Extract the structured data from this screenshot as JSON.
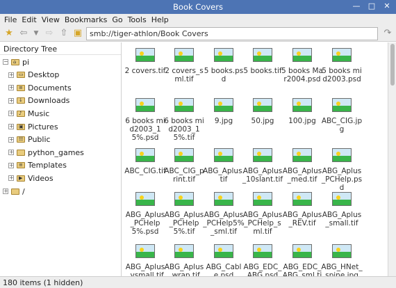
{
  "window": {
    "title": "Book Covers"
  },
  "menubar": {
    "items": [
      "File",
      "Edit",
      "View",
      "Bookmarks",
      "Go",
      "Tools",
      "Help"
    ]
  },
  "toolbar": {
    "location": "smb://tiger-athlon/Book Covers"
  },
  "sidebar": {
    "header": "Directory Tree",
    "items": [
      {
        "label": "pi",
        "glyph": "⌂",
        "expanded": true
      },
      {
        "label": "Desktop",
        "glyph": "▭"
      },
      {
        "label": "Documents",
        "glyph": "≡"
      },
      {
        "label": "Downloads",
        "glyph": "↓"
      },
      {
        "label": "Music",
        "glyph": "♪"
      },
      {
        "label": "Pictures",
        "glyph": "▣"
      },
      {
        "label": "Public",
        "glyph": "☷"
      },
      {
        "label": "python_games",
        "glyph": ""
      },
      {
        "label": "Templates",
        "glyph": "≡"
      },
      {
        "label": "Videos",
        "glyph": "▶"
      },
      {
        "label": "/",
        "glyph": ""
      }
    ]
  },
  "files": [
    {
      "name": "2 covers.tif"
    },
    {
      "name": "2 covers_sml.tif"
    },
    {
      "name": "5 books.psd"
    },
    {
      "name": "5 books.tif"
    },
    {
      "name": "5 books Mar2004.psd"
    },
    {
      "name": "5 books mid2003.psd"
    },
    {
      "name": "6 books mid2003_15%.psd"
    },
    {
      "name": "6 books mid2003_15%.tif"
    },
    {
      "name": "9.jpg"
    },
    {
      "name": "50.jpg"
    },
    {
      "name": "100.jpg"
    },
    {
      "name": "ABC_CIG.jpg"
    },
    {
      "name": "ABC_CIG.tif"
    },
    {
      "name": "ABC_CIG_print.tif"
    },
    {
      "name": "ABG_Aplus.tif"
    },
    {
      "name": "ABG_Aplus_10slant.tif"
    },
    {
      "name": "ABG_Aplus_med.tif"
    },
    {
      "name": "ABG_Aplus_PCHelp.psd"
    },
    {
      "name": "ABG_Aplus_PCHelp5%.psd"
    },
    {
      "name": "ABG_Aplus_PCHelp5%.tif"
    },
    {
      "name": "ABG_Aplus_PCHelp5%_sml.tif"
    },
    {
      "name": "ABG_Aplus_PCHelp_sml.tif"
    },
    {
      "name": "ABG_Aplus_REV.tif"
    },
    {
      "name": "ABG_Aplus_small.tif"
    },
    {
      "name": "ABG_Aplus_vsmall.tif"
    },
    {
      "name": "ABG_Aplus_wrap.tif"
    },
    {
      "name": "ABG_Cable.psd"
    },
    {
      "name": "ABG_EDC_ABG.psd"
    },
    {
      "name": "ABG_EDC_ABG_sml.tif"
    },
    {
      "name": "ABG_HNet_spine.jpg"
    }
  ],
  "statusbar": {
    "text": "180 items (1 hidden)"
  }
}
